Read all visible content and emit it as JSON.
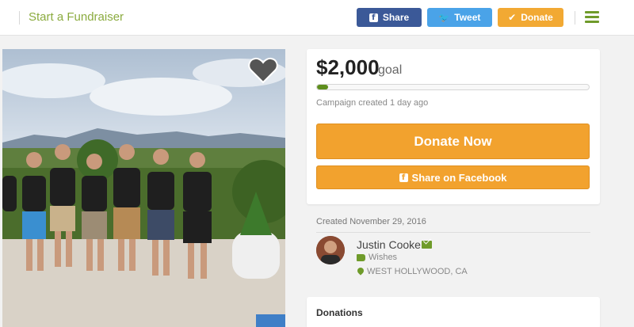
{
  "topbar": {
    "start_link": "Start a Fundraiser",
    "share_label": "Share",
    "tweet_label": "Tweet",
    "donate_label": "Donate",
    "icons": [
      "facebook-icon",
      "twitter-icon",
      "check-icon",
      "hamburger-menu-icon"
    ],
    "colors": {
      "share": "#3b5998",
      "tweet": "#4aa3e8",
      "donate": "#f2a933",
      "accent": "#6f9b2a"
    }
  },
  "campaign": {
    "goal_amount": "$2,000",
    "goal_label": "goal",
    "progress_fraction": 0.04,
    "created_ago": "Campaign created 1 day ago",
    "donate_now_label": "Donate Now",
    "share_facebook_label": "Share on Facebook",
    "button_color": "#f2a22e"
  },
  "organizer": {
    "created_date": "Created November 29, 2016",
    "name": "Justin Cooke",
    "category": "Wishes",
    "location": "WEST HOLLYWOOD, CA"
  },
  "donations": {
    "title": "Donations"
  }
}
